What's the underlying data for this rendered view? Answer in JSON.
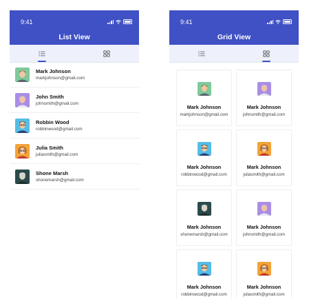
{
  "list_screen": {
    "time": "9:41",
    "title": "List View",
    "contacts": [
      {
        "name": "Mark Johnson",
        "email": "markjohnson@gmail.com",
        "avatar": "green-avatar"
      },
      {
        "name": "John Smith",
        "email": "johnsmith@gmail.com",
        "avatar": "purple-avatar"
      },
      {
        "name": "Robbin Wood",
        "email": "robbinwood@gmail.com",
        "avatar": "blue-avatar"
      },
      {
        "name": "Julia Smith",
        "email": "juliasmith@gmail.com",
        "avatar": "orange-avatar"
      },
      {
        "name": "Shone Marsh",
        "email": "shonemarsh@gmail.com",
        "avatar": "dark-teal-avatar"
      }
    ]
  },
  "grid_screen": {
    "time": "9:41",
    "title": "Grid View",
    "cards": [
      {
        "name": "Mark Johnson",
        "email": "markjohnson@gmail.com",
        "avatar": "green-avatar"
      },
      {
        "name": "Mark Johnson",
        "email": "johnsmith@gmail.com",
        "avatar": "purple-avatar"
      },
      {
        "name": "Mark Johnson",
        "email": "robbinwood@gmail.com",
        "avatar": "blue-avatar"
      },
      {
        "name": "Mark Johnson",
        "email": "juliasmith@gmail.com",
        "avatar": "orange-avatar"
      },
      {
        "name": "Mark Johnson",
        "email": "shonemarsh@gmail.com",
        "avatar": "dark-teal-avatar"
      },
      {
        "name": "Mark Johnson",
        "email": "johnsmith@gmail.com",
        "avatar": "purple-avatar"
      },
      {
        "name": "Mark Johnson",
        "email": "robbinwood@gmail.com",
        "avatar": "blue-avatar"
      },
      {
        "name": "Mark Johnson",
        "email": "juliasmith@gmail.com",
        "avatar": "orange-avatar"
      }
    ]
  },
  "tabs": [
    {
      "icon": "list-icon",
      "label": ""
    },
    {
      "icon": "grid-icon",
      "label": ""
    }
  ],
  "status_icons": [
    "signal-icon",
    "wifi-icon",
    "battery-icon"
  ],
  "colors": {
    "primary": "#3f51c4",
    "tab_background": "#eef0fb",
    "divider": "#eeeeee",
    "avatar_backgrounds": {
      "green": "#7fc99a",
      "purple": "#a98de6",
      "blue": "#55bde4",
      "orange": "#f2a33a",
      "dark-teal": "#2b4a4a"
    }
  }
}
